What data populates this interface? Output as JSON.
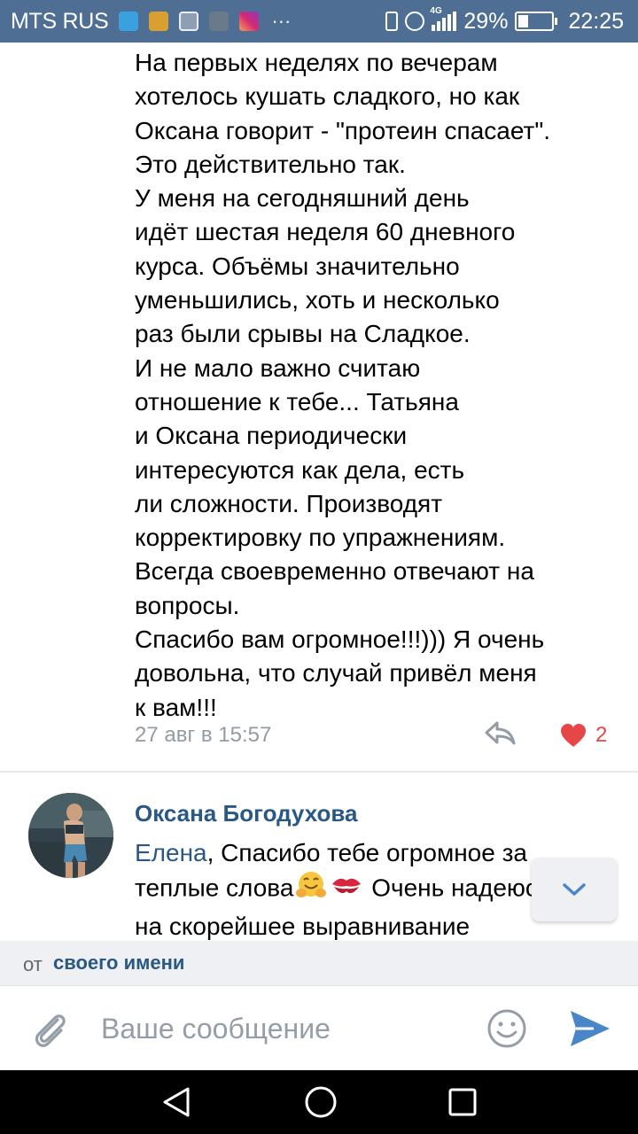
{
  "status_bar": {
    "carrier": "MTS RUS",
    "network_type": "4G",
    "battery_percent": "29%",
    "time": "22:25",
    "icons": [
      "fish-app-icon",
      "lock-app-icon",
      "gallery-icon",
      "photo-icon",
      "instagram-icon",
      "more-icon",
      "vibrate-icon",
      "alarm-icon",
      "signal-icon",
      "battery-icon"
    ]
  },
  "message": {
    "lines": [
      "На первых неделях по вечерам",
      "хотелось кушать сладкого, но как",
      "Оксана говорит - \"протеин спасает\".",
      "Это действительно так.",
      "У меня на сегодняшний день",
      "идёт шестая неделя 60 дневного",
      "курса. Объёмы значительно",
      "уменьшились, хоть и несколько",
      "раз были срывы на Сладкое.",
      "И не мало важно считаю",
      "отношение к тебе... Татьяна",
      "и Оксана периодически",
      "интересуются как дела, есть",
      "ли сложности. Производят",
      "корректировку по упражнениям.",
      "Всегда своевременно отвечают на",
      "вопросы.",
      "Спасибо вам огромное!!!))) Я очень",
      "довольна, что случай привёл меня",
      "к вам!!!"
    ],
    "timestamp": "27 авг в 15:57",
    "like_count": "2"
  },
  "comment": {
    "author": "Оксана Богодухова",
    "mention": "Елена",
    "line1_rest": ", Спасибо тебе огромное за",
    "line2_before": "теплые слова",
    "line2_after": " Очень надеюсь",
    "line3": "на скорейшее выравнивание"
  },
  "from_bar": {
    "label": "от",
    "link": "своего имени"
  },
  "composer": {
    "placeholder": "Ваше сообщение"
  },
  "colors": {
    "status_bar": "#4e6e93",
    "link": "#2a5885",
    "like": "#e64646",
    "send": "#4a86c7",
    "meta": "#939ba3"
  }
}
